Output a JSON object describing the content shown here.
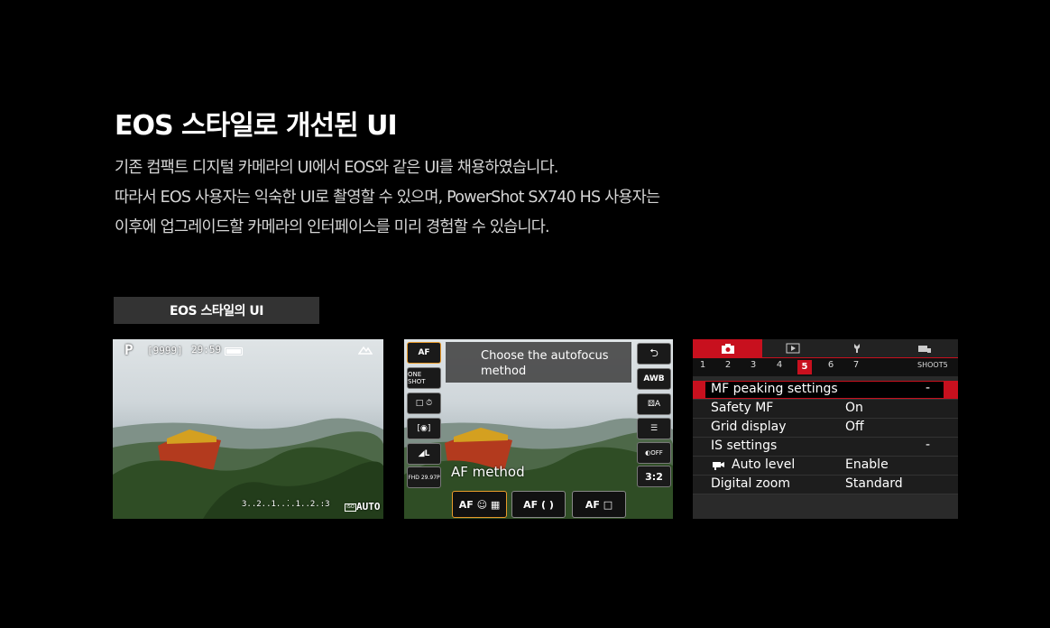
{
  "heading": "EOS 스타일로 개선된 UI",
  "description": [
    "기존 컴팩트 디지털 카메라의 UI에서 EOS와 같은 UI를 채용하였습니다.",
    "따라서 EOS 사용자는 익숙한 UI로 촬영할 수 있으며, PowerShot SX740 HS 사용자는",
    "이후에 업그레이드할 카메라의 인터페이스를 미리 경험할 수 있습니다."
  ],
  "badge_label": "EOS 스타일의 UI",
  "shot1": {
    "mode": "P",
    "shots_remaining": "[9999]",
    "time_remaining": "29:59",
    "exposure_scale": "3..2..1..̇..1..2.:3",
    "iso": "AUTO"
  },
  "shot2": {
    "tooltip_line1": "Choose the autofocus",
    "tooltip_line2": "method",
    "caption": "AF method",
    "left_buttons": [
      "AF",
      "ONE SHOT",
      "□ ⏱",
      "[◉]",
      "◢L",
      "FHD 29.97P"
    ],
    "right_buttons": [
      "⮌",
      "AWB",
      "⚄A",
      "☰",
      "◐OFF",
      "3:2"
    ],
    "bottom_buttons": [
      "AF ☺ ▦",
      "AF ( )",
      "AF □"
    ]
  },
  "shot3": {
    "pages": [
      "1",
      "2",
      "3",
      "4",
      "5",
      "6",
      "7"
    ],
    "active_page": "5",
    "tab_label": "SHOOT5",
    "rows": [
      {
        "label": "MF peaking settings",
        "value": "",
        "dash": "-"
      },
      {
        "label": "Safety MF",
        "value": "On",
        "dash": ""
      },
      {
        "label": "Grid display",
        "value": "Off",
        "dash": ""
      },
      {
        "label": "IS settings",
        "value": "",
        "dash": "-"
      },
      {
        "label": "Auto level",
        "value": "Enable",
        "dash": ""
      },
      {
        "label": "Digital zoom",
        "value": "Standard",
        "dash": ""
      }
    ]
  },
  "colors": {
    "accent_red": "#c8101e",
    "accent_orange": "#e89a2a",
    "background": "#000000"
  }
}
